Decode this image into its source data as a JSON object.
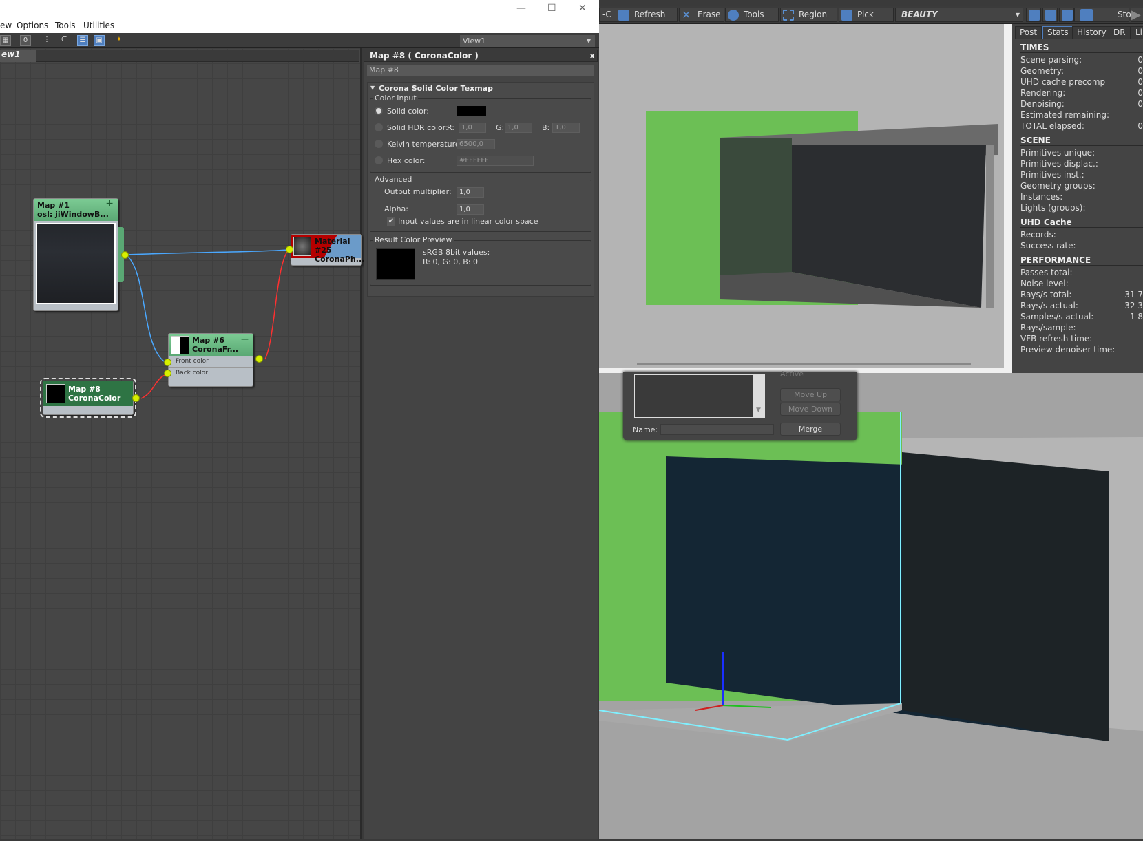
{
  "window": {
    "menu": [
      "ew",
      "Options",
      "Tools",
      "Utilities"
    ],
    "minimize": "—",
    "maximize": "☐",
    "close": "✕"
  },
  "toolbar": {
    "view_select": "View1",
    "icons": [
      "select-icon",
      "layout-icon",
      "move-children-icon",
      "hide-children-icon",
      "show-background-icon",
      "layout-all-icon",
      "pick-material-icon"
    ]
  },
  "node_view": {
    "tab": "ew1",
    "nodes": [
      {
        "id": "map1",
        "title": "Map #1",
        "subtitle": "osl:  jiWindowB...",
        "badge": "+"
      },
      {
        "id": "map6",
        "title": "Map #6",
        "subtitle": "CoronaFr...",
        "badge": "—",
        "slots": [
          "Front color",
          "Back color"
        ]
      },
      {
        "id": "map8",
        "title": "Map #8",
        "subtitle": "CoronaColor"
      },
      {
        "id": "mat25",
        "title": "Material #25",
        "subtitle": "CoronaPh..."
      }
    ]
  },
  "material_panel": {
    "title": "Map #8  ( CoronaColor )",
    "close": "x",
    "name_field": "Map #8",
    "rollout": "Corona Solid Color Texmap",
    "color_input": {
      "label": "Color Input",
      "solid_color": "Solid color:",
      "solid_color_value": "#000000",
      "hdr": "Solid HDR color:",
      "r_label": "R:",
      "g_label": "G:",
      "b_label": "B:",
      "r": "1,0",
      "g": "1,0",
      "b": "1,0",
      "kelvin": "Kelvin temperature:",
      "kelvin_value": "6500,0",
      "hex": "Hex color:",
      "hex_value": "#FFFFFF",
      "selected": "solid"
    },
    "advanced": {
      "label": "Advanced",
      "output_multiplier": "Output multiplier:",
      "output_multiplier_value": "1,0",
      "alpha": "Alpha:",
      "alpha_value": "1,0",
      "linear": "Input values are in linear color space",
      "linear_checked": true
    },
    "preview": {
      "label": "Result Color Preview",
      "line1": "sRGB 8bit values:",
      "line2": "R: 0, G: 0, B: 0"
    }
  },
  "vfb": {
    "toolbar": {
      "prefix": "-C",
      "refresh": "Refresh",
      "erase": "Erase",
      "tools": "Tools",
      "region": "Region",
      "pick": "Pick",
      "channel": "BEAUTY",
      "stop": "Stop"
    },
    "tabs": [
      "Post",
      "Stats",
      "History",
      "DR",
      "Li"
    ],
    "active_tab": "Stats",
    "stats": [
      {
        "section": "TIMES",
        "rows": [
          {
            "k": "Scene parsing:",
            "v": "0"
          },
          {
            "k": "Geometry:",
            "v": "0"
          },
          {
            "k": "UHD cache precomp",
            "v": "0"
          },
          {
            "k": "Rendering:",
            "v": "0"
          },
          {
            "k": "Denoising:",
            "v": "0"
          },
          {
            "k": "Estimated remaining:",
            "v": ""
          },
          {
            "k": "TOTAL elapsed:",
            "v": "0"
          }
        ]
      },
      {
        "section": "SCENE",
        "rows": [
          {
            "k": "Primitives unique:",
            "v": ""
          },
          {
            "k": "Primitives displac.:",
            "v": ""
          },
          {
            "k": "Primitives inst.:",
            "v": ""
          },
          {
            "k": "Geometry groups:",
            "v": ""
          },
          {
            "k": "Instances:",
            "v": ""
          },
          {
            "k": "Lights (groups):",
            "v": ""
          }
        ]
      },
      {
        "section": "UHD Cache",
        "rows": [
          {
            "k": "Records:",
            "v": ""
          },
          {
            "k": "Success rate:",
            "v": ""
          }
        ]
      },
      {
        "section": "PERFORMANCE",
        "rows": [
          {
            "k": "Passes total:",
            "v": ""
          },
          {
            "k": "Noise level:",
            "v": ""
          },
          {
            "k": "Rays/s total:",
            "v": "31 7"
          },
          {
            "k": "Rays/s actual:",
            "v": "32 3"
          },
          {
            "k": "Samples/s actual:",
            "v": "1 8"
          },
          {
            "k": "Rays/sample:",
            "v": ""
          },
          {
            "k": "VFB refresh time:",
            "v": ""
          },
          {
            "k": "Preview denoiser time:",
            "v": ""
          }
        ]
      }
    ]
  },
  "dialog": {
    "top_label": "Active",
    "move_up": "Move Up",
    "move_down": "Move Down",
    "name_label": "Name:",
    "name_value": "",
    "merge": "Merge"
  },
  "colors": {
    "node_header": "#6abb84",
    "socket": "#d7f000",
    "wire_blue": "#4aa8ff",
    "wire_red": "#ff3030",
    "accent": "#4f7fbf",
    "green_box": "#6cbf55"
  }
}
